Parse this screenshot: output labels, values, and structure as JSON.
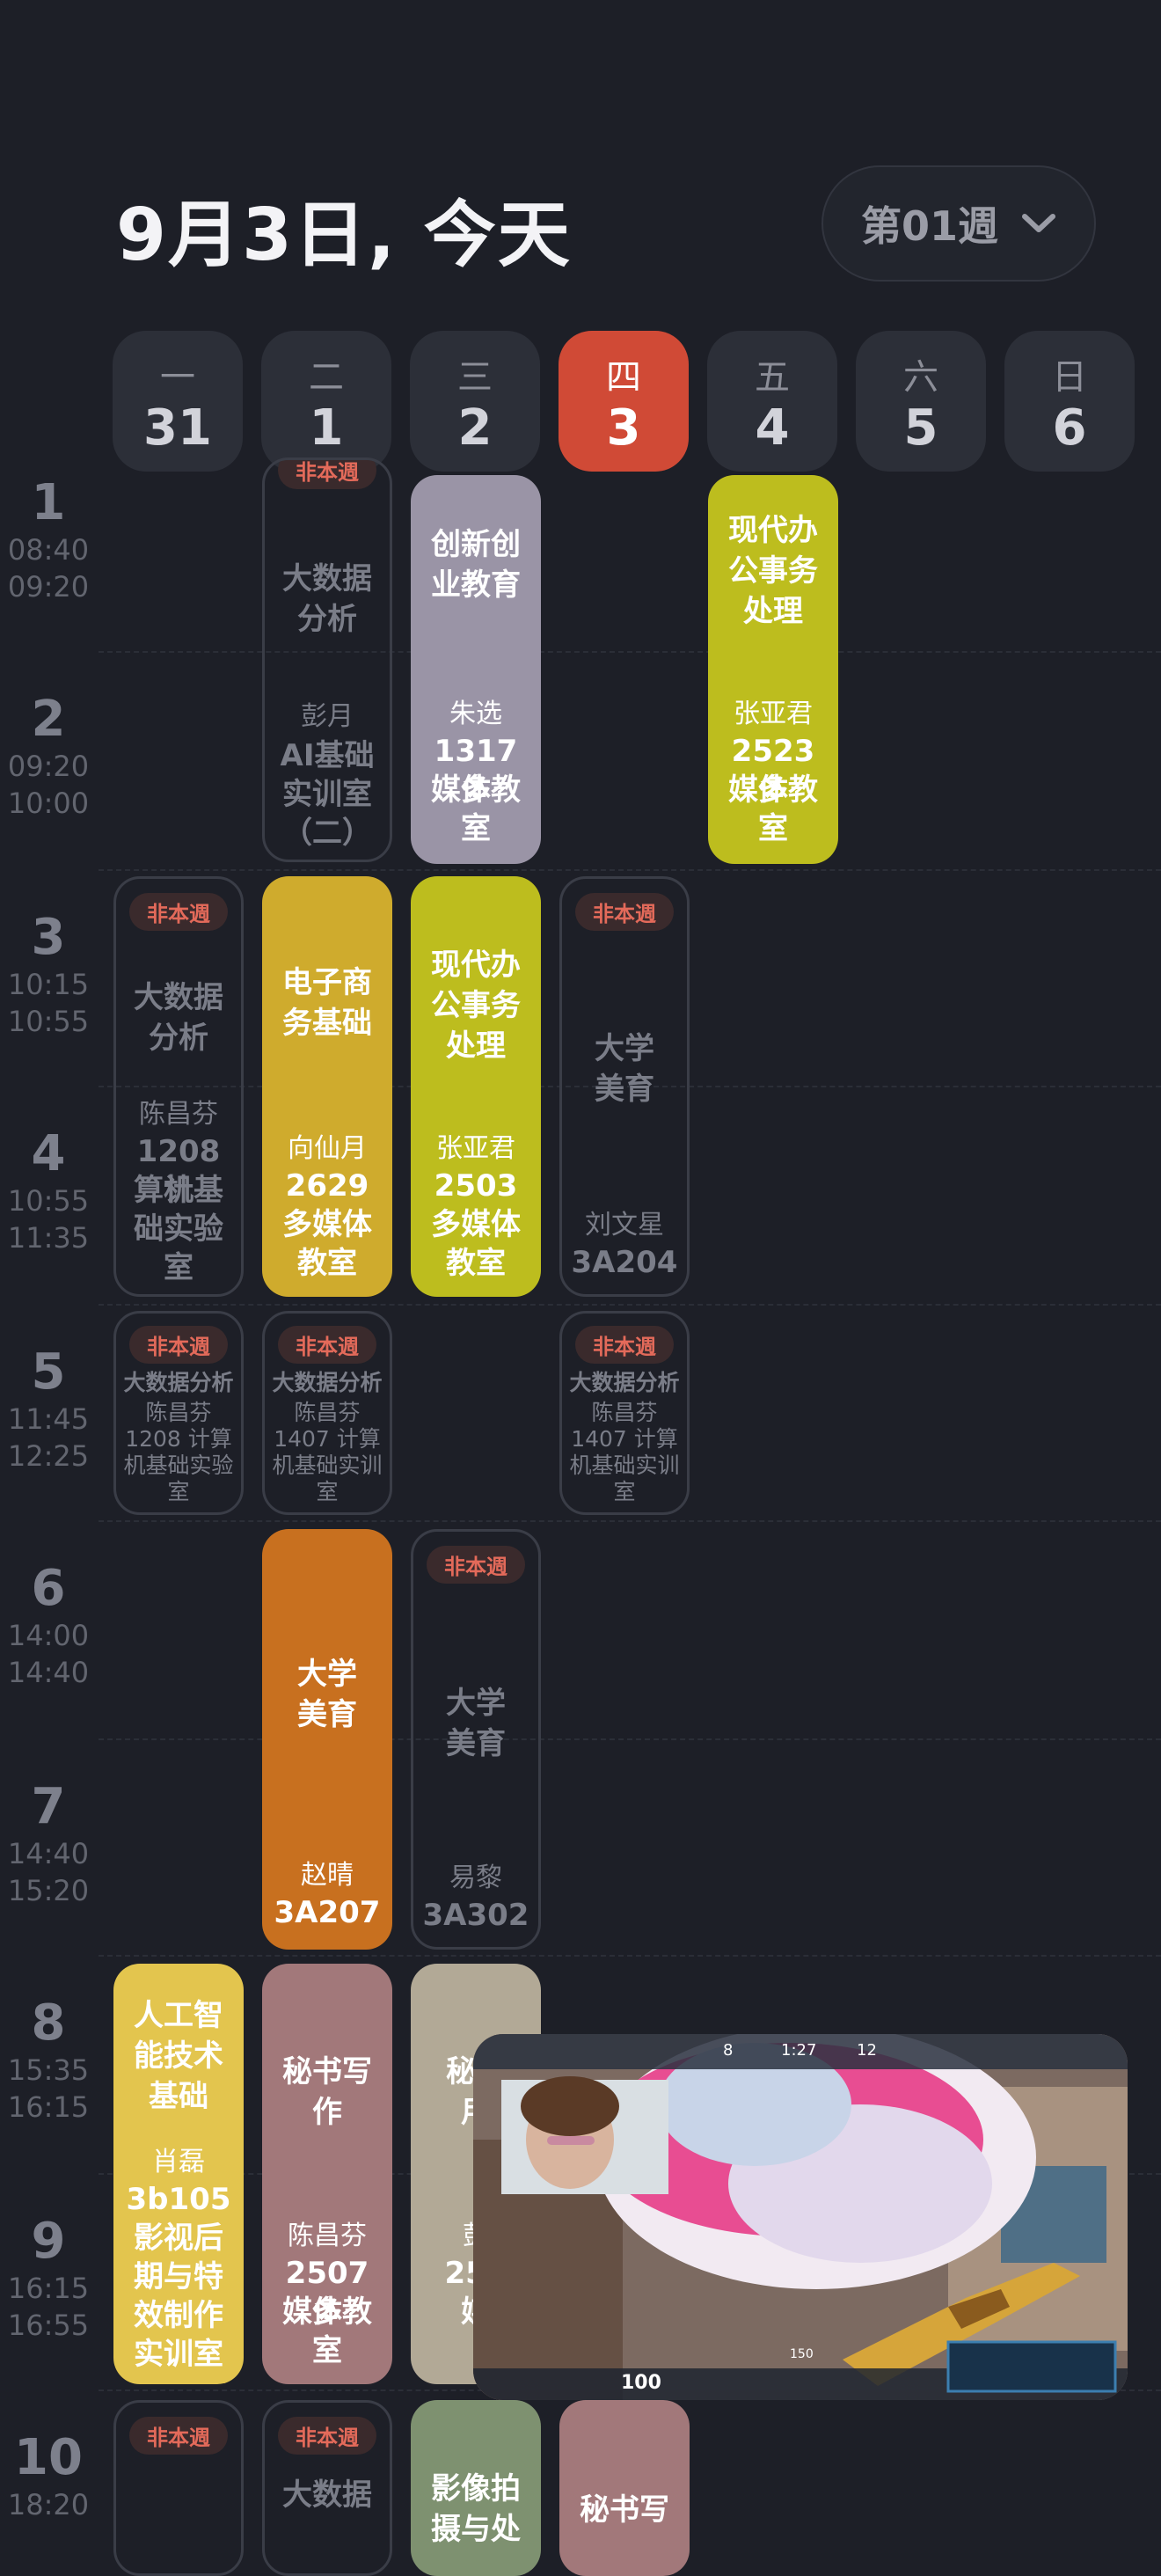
{
  "header": {
    "title": "9月3日, 今天",
    "week_label": "第01週"
  },
  "days": [
    {
      "weekday": "一",
      "date": "31",
      "today": false
    },
    {
      "weekday": "二",
      "date": "1",
      "today": false
    },
    {
      "weekday": "三",
      "date": "2",
      "today": false
    },
    {
      "weekday": "四",
      "date": "3",
      "today": true
    },
    {
      "weekday": "五",
      "date": "4",
      "today": false
    },
    {
      "weekday": "六",
      "date": "5",
      "today": false
    },
    {
      "weekday": "日",
      "date": "6",
      "today": false
    }
  ],
  "periods": [
    {
      "num": "1",
      "start": "08:40",
      "end": "09:20"
    },
    {
      "num": "2",
      "start": "09:20",
      "end": "10:00"
    },
    {
      "num": "3",
      "start": "10:15",
      "end": "10:55"
    },
    {
      "num": "4",
      "start": "10:55",
      "end": "11:35"
    },
    {
      "num": "5",
      "start": "11:45",
      "end": "12:25"
    },
    {
      "num": "6",
      "start": "14:00",
      "end": "14:40"
    },
    {
      "num": "7",
      "start": "14:40",
      "end": "15:20"
    },
    {
      "num": "8",
      "start": "15:35",
      "end": "16:15"
    },
    {
      "num": "9",
      "start": "16:15",
      "end": "16:55"
    },
    {
      "num": "10",
      "start": "18:20",
      "end": ""
    }
  ],
  "non_week_label": "非本週",
  "courses": {
    "tue_12": {
      "name": "大数据分析",
      "name_l1": "大数据",
      "name_l2": "分析",
      "teacher": "彭月",
      "room_l1": "AI基础",
      "room_l2": "实训室",
      "room_l3": "（二）"
    },
    "wed_12": {
      "name_l1": "创新创",
      "name_l2": "业教育",
      "teacher": "朱选",
      "room_l1": "1317 多",
      "room_l2": "媒体教",
      "room_l3": "室",
      "color": "#9a94a6"
    },
    "fri_12": {
      "name_l1": "现代办",
      "name_l2": "公事务",
      "name_l3": "处理",
      "teacher": "张亚君",
      "room_l1": "2523 多",
      "room_l2": "媒体教",
      "room_l3": "室",
      "color": "#bdbd1e"
    },
    "mon_34": {
      "name_l1": "大数据",
      "name_l2": "分析",
      "teacher": "陈昌芬",
      "room_l1": "1208 计",
      "room_l2": "算机基",
      "room_l3": "础实验",
      "room_l4": "室"
    },
    "tue_34": {
      "name_l1": "电子商",
      "name_l2": "务基础",
      "teacher": "向仙月",
      "room_l1": "2629",
      "room_l2": "多媒体",
      "room_l3": "教室",
      "color": "#cfab2d"
    },
    "wed_34": {
      "name_l1": "现代办",
      "name_l2": "公事务",
      "name_l3": "处理",
      "teacher": "张亚君",
      "room_l1": "2503",
      "room_l2": "多媒体",
      "room_l3": "教室",
      "color": "#bdbd1e"
    },
    "thu_34": {
      "name_l1": "大学",
      "name_l2": "美育",
      "teacher": "刘文星",
      "room_l1": "3A204"
    },
    "mon_5": {
      "name": "大数据分析",
      "teacher": "陈昌芬",
      "room_l1": "1208 计算",
      "room_l2": "机基础实验",
      "room_l3": "室"
    },
    "tue_5": {
      "name": "大数据分析",
      "teacher": "陈昌芬",
      "room_l1": "1407 计算",
      "room_l2": "机基础实训",
      "room_l3": "室"
    },
    "thu_5": {
      "name": "大数据分析",
      "teacher": "陈昌芬",
      "room_l1": "1407 计算",
      "room_l2": "机基础实训",
      "room_l3": "室"
    },
    "tue_67": {
      "name_l1": "大学",
      "name_l2": "美育",
      "teacher": "赵晴",
      "room_l1": "3A207",
      "color": "#c8701f"
    },
    "wed_67": {
      "name_l1": "大学",
      "name_l2": "美育",
      "teacher": "易黎",
      "room_l1": "3A302"
    },
    "mon_89": {
      "name_l1": "人工智",
      "name_l2": "能技术",
      "name_l3": "基础",
      "teacher": "肖磊",
      "room_l1": "3b105",
      "room_l2": "影视后",
      "room_l3": "期与特",
      "room_l4": "效制作",
      "room_l5": "实训室",
      "color": "#e3c54e"
    },
    "tue_89": {
      "name_l1": "秘书写",
      "name_l2": "作",
      "teacher": "陈昌芬",
      "room_l1": "2507 多",
      "room_l2": "媒体教",
      "room_l3": "室",
      "color": "#a2787a"
    },
    "wed_89": {
      "name_l1": "秘书",
      "name_l2": "用",
      "teacher": "彭",
      "room_l1": "250",
      "room_l2": "媒",
      "color": "#b2a996"
    },
    "mon_10": {},
    "tue_10": {
      "name_l1": "大数据"
    },
    "wed_10": {
      "name_l1": "影像拍",
      "name_l2": "摄与处",
      "color": "#7e9170"
    },
    "thu_10": {
      "name_l1": "秘书写",
      "color": "#a2787a"
    }
  },
  "pip": {
    "hud_time": "1:27",
    "score_left": "8",
    "score_right": "12",
    "health": "100",
    "ammo": "150"
  }
}
